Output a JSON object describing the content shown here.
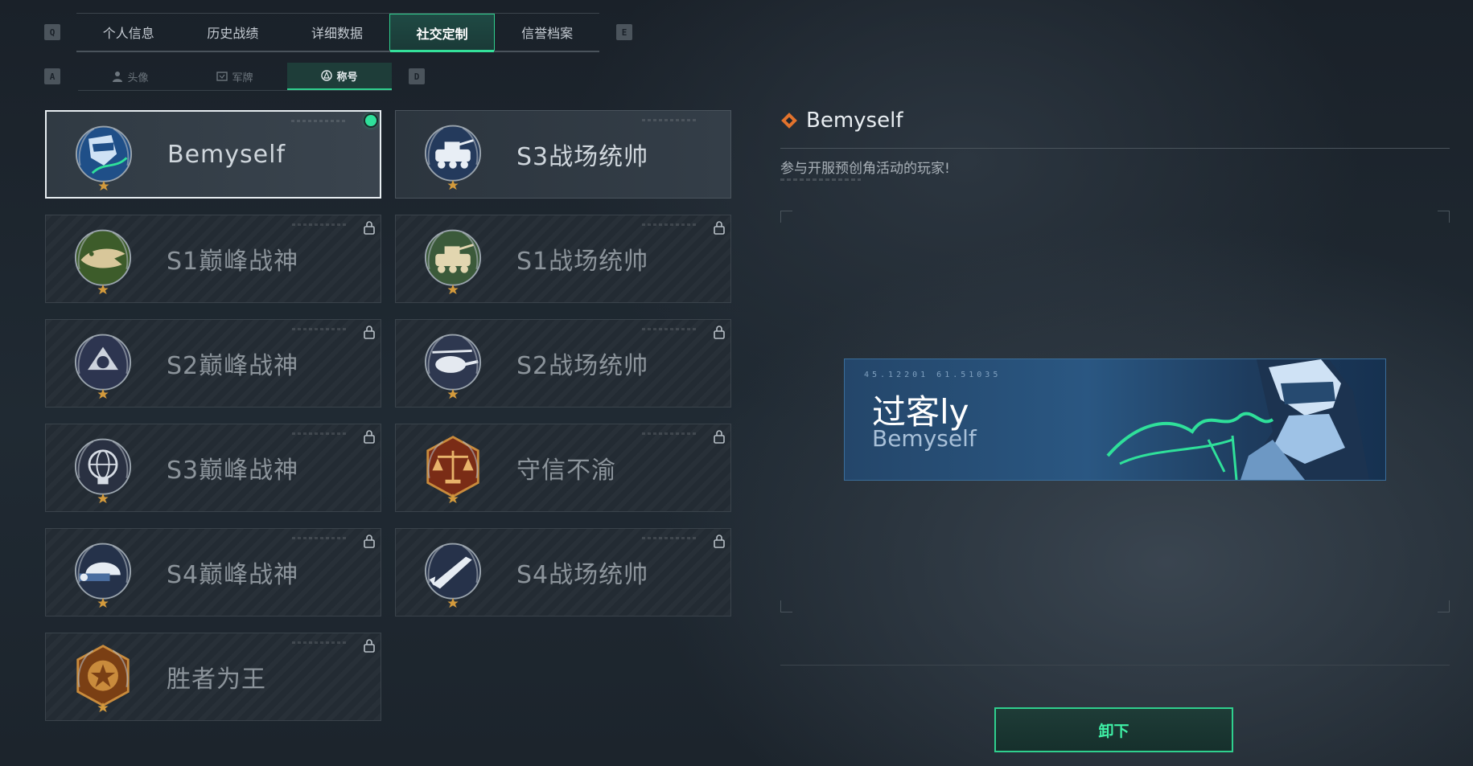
{
  "main_tabs": [
    "个人信息",
    "历史战绩",
    "详细数据",
    "社交定制",
    "信誉档案"
  ],
  "main_tabs_active": 3,
  "key_left": "Q",
  "key_right": "E",
  "sub_tabs": [
    {
      "label": "头像",
      "icon": "person-icon"
    },
    {
      "label": "军牌",
      "icon": "dogtag-icon"
    },
    {
      "label": "称号",
      "icon": "title-badge-icon"
    }
  ],
  "sub_tabs_active": 2,
  "sub_key_left": "A",
  "sub_key_right": "D",
  "titles": [
    {
      "name": "Bemyself",
      "state": "selected",
      "medal": "soldier-signature-medal-icon"
    },
    {
      "name": "S3战场统帅",
      "state": "unlocked",
      "medal": "armored-vehicle-medal-icon"
    },
    {
      "name": "S1巅峰战神",
      "state": "locked",
      "medal": "crocodile-medal-icon"
    },
    {
      "name": "S1战场统帅",
      "state": "locked",
      "medal": "tank-medal-icon"
    },
    {
      "name": "S2巅峰战神",
      "state": "locked",
      "medal": "pyramid-medal-icon"
    },
    {
      "name": "S2战场统帅",
      "state": "locked",
      "medal": "helicopter-medal-icon"
    },
    {
      "name": "S3巅峰战神",
      "state": "locked",
      "medal": "globe-medal-icon"
    },
    {
      "name": "守信不渝",
      "state": "locked",
      "medal": "scales-medal-icon"
    },
    {
      "name": "S4巅峰战神",
      "state": "locked",
      "medal": "helmet-medal-icon"
    },
    {
      "name": "S4战场统帅",
      "state": "locked",
      "medal": "missile-medal-icon"
    },
    {
      "name": "胜者为王",
      "state": "locked",
      "medal": "star-medal-icon"
    }
  ],
  "detail": {
    "title": "Bemyself",
    "description": "参与开服预创角活动的玩家!",
    "banner_player": "过客ly",
    "banner_title": "Bemyself",
    "banner_code": "45.12201  61.51035"
  },
  "unequip_label": "卸下",
  "colors": {
    "accent": "#2fd08e",
    "banner": "#2a5782"
  }
}
